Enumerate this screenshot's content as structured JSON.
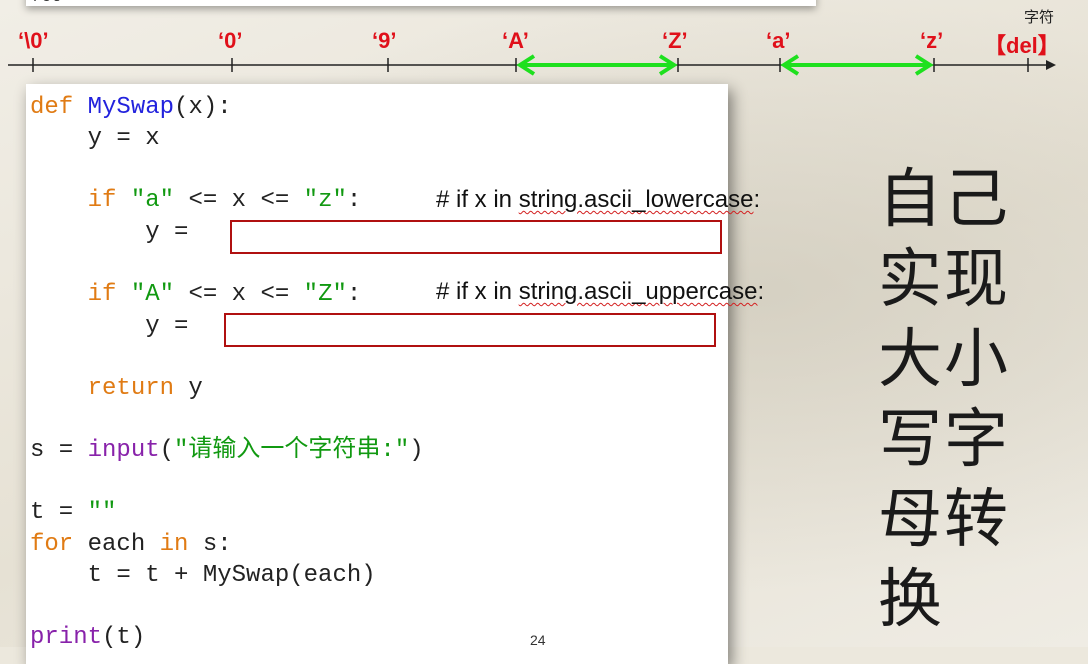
{
  "top_fragment": "ret",
  "ruler": {
    "corner_label": "字符",
    "labels": [
      "‘\\0’",
      "‘0’",
      "‘9’",
      "‘A’",
      "‘Z’",
      "‘a’",
      "‘z’",
      "【del】"
    ],
    "colors": {
      "label": "#e0101a",
      "arrow": "#1ee01e",
      "axis": "#222222"
    }
  },
  "code": {
    "def": "def",
    "func_name": "MySwap",
    "def_rest": "(x):",
    "line_y_eq_x": "    y = x",
    "if1_kw": "if",
    "if1_cond_a": "\"a\"",
    "if1_ops": " <= x <= ",
    "if1_cond_z": "\"z\"",
    "colon": ":",
    "comment1_pre": "# if x in ",
    "comment1_squig": "string.ascii_lowercase",
    "comment1_post": ":",
    "y_eq": "y =",
    "if2_kw": "if",
    "if2_cond_a": "\"A\"",
    "if2_ops": " <= x <= ",
    "if2_cond_z": "\"Z\"",
    "comment2_pre": "# if x in ",
    "comment2_squig": "string.ascii_uppercase",
    "comment2_post": ":",
    "return_kw": "return",
    "return_var": " y",
    "s_assign": "s = ",
    "input_fn": "input",
    "input_open": "(",
    "input_str": "\"请输入一个字符串:\"",
    "input_close": ")",
    "t_assign": "t = ",
    "t_empty": "\"\"",
    "for_kw": "for",
    "for_mid": " each ",
    "in_kw": "in",
    "for_end": " s:",
    "t_concat": "    t = t + MySwap(each)",
    "print_fn": "print",
    "print_args": "(t)"
  },
  "page_number": "24",
  "side_title": [
    "自己",
    "实现",
    "大小",
    "写字",
    "母转",
    "换"
  ]
}
